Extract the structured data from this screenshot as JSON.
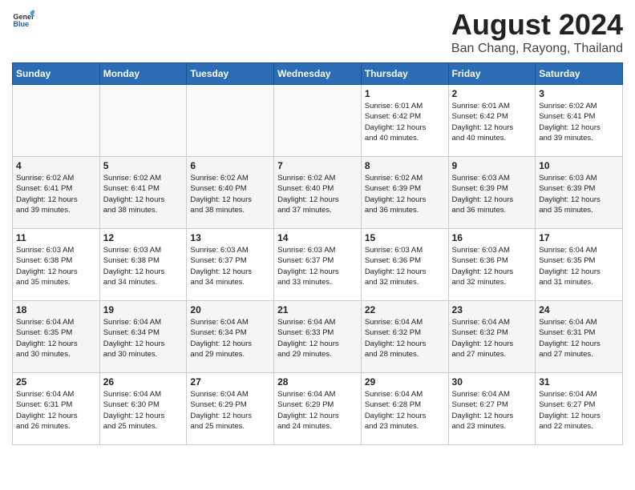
{
  "header": {
    "logo_general": "General",
    "logo_blue": "Blue",
    "title": "August 2024",
    "subtitle": "Ban Chang, Rayong, Thailand"
  },
  "days_of_week": [
    "Sunday",
    "Monday",
    "Tuesday",
    "Wednesday",
    "Thursday",
    "Friday",
    "Saturday"
  ],
  "weeks": [
    [
      {
        "day": "",
        "info": ""
      },
      {
        "day": "",
        "info": ""
      },
      {
        "day": "",
        "info": ""
      },
      {
        "day": "",
        "info": ""
      },
      {
        "day": "1",
        "info": "Sunrise: 6:01 AM\nSunset: 6:42 PM\nDaylight: 12 hours\nand 40 minutes."
      },
      {
        "day": "2",
        "info": "Sunrise: 6:01 AM\nSunset: 6:42 PM\nDaylight: 12 hours\nand 40 minutes."
      },
      {
        "day": "3",
        "info": "Sunrise: 6:02 AM\nSunset: 6:41 PM\nDaylight: 12 hours\nand 39 minutes."
      }
    ],
    [
      {
        "day": "4",
        "info": "Sunrise: 6:02 AM\nSunset: 6:41 PM\nDaylight: 12 hours\nand 39 minutes."
      },
      {
        "day": "5",
        "info": "Sunrise: 6:02 AM\nSunset: 6:41 PM\nDaylight: 12 hours\nand 38 minutes."
      },
      {
        "day": "6",
        "info": "Sunrise: 6:02 AM\nSunset: 6:40 PM\nDaylight: 12 hours\nand 38 minutes."
      },
      {
        "day": "7",
        "info": "Sunrise: 6:02 AM\nSunset: 6:40 PM\nDaylight: 12 hours\nand 37 minutes."
      },
      {
        "day": "8",
        "info": "Sunrise: 6:02 AM\nSunset: 6:39 PM\nDaylight: 12 hours\nand 36 minutes."
      },
      {
        "day": "9",
        "info": "Sunrise: 6:03 AM\nSunset: 6:39 PM\nDaylight: 12 hours\nand 36 minutes."
      },
      {
        "day": "10",
        "info": "Sunrise: 6:03 AM\nSunset: 6:39 PM\nDaylight: 12 hours\nand 35 minutes."
      }
    ],
    [
      {
        "day": "11",
        "info": "Sunrise: 6:03 AM\nSunset: 6:38 PM\nDaylight: 12 hours\nand 35 minutes."
      },
      {
        "day": "12",
        "info": "Sunrise: 6:03 AM\nSunset: 6:38 PM\nDaylight: 12 hours\nand 34 minutes."
      },
      {
        "day": "13",
        "info": "Sunrise: 6:03 AM\nSunset: 6:37 PM\nDaylight: 12 hours\nand 34 minutes."
      },
      {
        "day": "14",
        "info": "Sunrise: 6:03 AM\nSunset: 6:37 PM\nDaylight: 12 hours\nand 33 minutes."
      },
      {
        "day": "15",
        "info": "Sunrise: 6:03 AM\nSunset: 6:36 PM\nDaylight: 12 hours\nand 32 minutes."
      },
      {
        "day": "16",
        "info": "Sunrise: 6:03 AM\nSunset: 6:36 PM\nDaylight: 12 hours\nand 32 minutes."
      },
      {
        "day": "17",
        "info": "Sunrise: 6:04 AM\nSunset: 6:35 PM\nDaylight: 12 hours\nand 31 minutes."
      }
    ],
    [
      {
        "day": "18",
        "info": "Sunrise: 6:04 AM\nSunset: 6:35 PM\nDaylight: 12 hours\nand 30 minutes."
      },
      {
        "day": "19",
        "info": "Sunrise: 6:04 AM\nSunset: 6:34 PM\nDaylight: 12 hours\nand 30 minutes."
      },
      {
        "day": "20",
        "info": "Sunrise: 6:04 AM\nSunset: 6:34 PM\nDaylight: 12 hours\nand 29 minutes."
      },
      {
        "day": "21",
        "info": "Sunrise: 6:04 AM\nSunset: 6:33 PM\nDaylight: 12 hours\nand 29 minutes."
      },
      {
        "day": "22",
        "info": "Sunrise: 6:04 AM\nSunset: 6:32 PM\nDaylight: 12 hours\nand 28 minutes."
      },
      {
        "day": "23",
        "info": "Sunrise: 6:04 AM\nSunset: 6:32 PM\nDaylight: 12 hours\nand 27 minutes."
      },
      {
        "day": "24",
        "info": "Sunrise: 6:04 AM\nSunset: 6:31 PM\nDaylight: 12 hours\nand 27 minutes."
      }
    ],
    [
      {
        "day": "25",
        "info": "Sunrise: 6:04 AM\nSunset: 6:31 PM\nDaylight: 12 hours\nand 26 minutes."
      },
      {
        "day": "26",
        "info": "Sunrise: 6:04 AM\nSunset: 6:30 PM\nDaylight: 12 hours\nand 25 minutes."
      },
      {
        "day": "27",
        "info": "Sunrise: 6:04 AM\nSunset: 6:29 PM\nDaylight: 12 hours\nand 25 minutes."
      },
      {
        "day": "28",
        "info": "Sunrise: 6:04 AM\nSunset: 6:29 PM\nDaylight: 12 hours\nand 24 minutes."
      },
      {
        "day": "29",
        "info": "Sunrise: 6:04 AM\nSunset: 6:28 PM\nDaylight: 12 hours\nand 23 minutes."
      },
      {
        "day": "30",
        "info": "Sunrise: 6:04 AM\nSunset: 6:27 PM\nDaylight: 12 hours\nand 23 minutes."
      },
      {
        "day": "31",
        "info": "Sunrise: 6:04 AM\nSunset: 6:27 PM\nDaylight: 12 hours\nand 22 minutes."
      }
    ]
  ]
}
